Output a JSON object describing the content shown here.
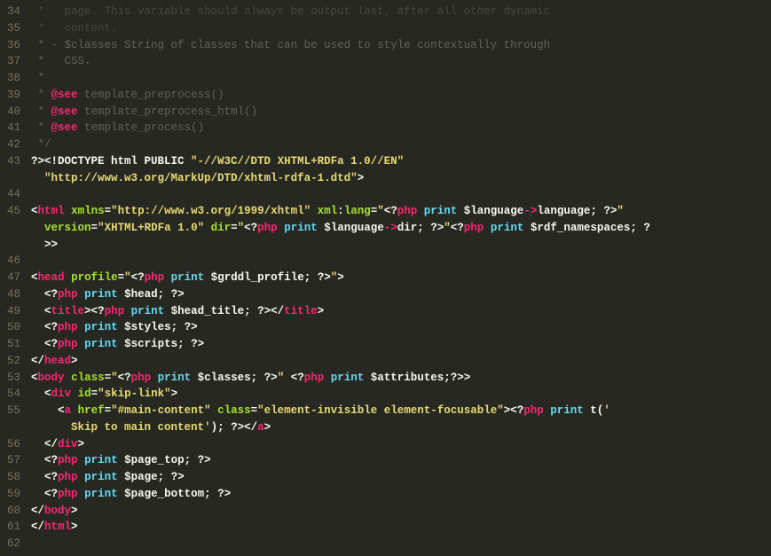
{
  "lines": [
    {
      "num": 34,
      "segs": [
        {
          "cls": "c-comment-faint",
          "t": " *   page. This variable should always be output last, after all other dynamic"
        }
      ]
    },
    {
      "num": 35,
      "segs": [
        {
          "cls": "c-comment-faint",
          "t": " *   content."
        }
      ]
    },
    {
      "num": 36,
      "segs": [
        {
          "cls": "c-comment",
          "t": " * - $classes String of classes that can be used to style contextually through"
        }
      ]
    },
    {
      "num": 37,
      "segs": [
        {
          "cls": "c-comment",
          "t": " *   CSS."
        }
      ]
    },
    {
      "num": 38,
      "segs": [
        {
          "cls": "c-comment",
          "t": " *"
        }
      ]
    },
    {
      "num": 39,
      "segs": [
        {
          "cls": "c-comment",
          "t": " * "
        },
        {
          "cls": "c-tag-red bold",
          "t": "@see"
        },
        {
          "cls": "c-comment",
          "t": " template_preprocess()"
        }
      ]
    },
    {
      "num": 40,
      "segs": [
        {
          "cls": "c-comment",
          "t": " * "
        },
        {
          "cls": "c-tag-red bold",
          "t": "@see"
        },
        {
          "cls": "c-comment",
          "t": " template_preprocess_html()"
        }
      ]
    },
    {
      "num": 41,
      "segs": [
        {
          "cls": "c-comment",
          "t": " * "
        },
        {
          "cls": "c-tag-red bold",
          "t": "@see"
        },
        {
          "cls": "c-comment",
          "t": " template_process()"
        }
      ]
    },
    {
      "num": 42,
      "segs": [
        {
          "cls": "c-comment",
          "t": " */"
        }
      ]
    },
    {
      "num": 43,
      "segs": [
        {
          "cls": "c-white bold",
          "t": "?><!DOCTYPE html PUBLIC "
        },
        {
          "cls": "c-string bold",
          "t": "\"-//W3C//DTD XHTML+RDFa 1.0//EN\""
        }
      ]
    },
    {
      "num": " ",
      "segs": [
        {
          "cls": "c-string bold",
          "t": "  \"http://www.w3.org/MarkUp/DTD/xhtml-rdfa-1.dtd\""
        },
        {
          "cls": "c-white bold",
          "t": ">"
        }
      ]
    },
    {
      "num": 44,
      "segs": []
    },
    {
      "num": 45,
      "segs": [
        {
          "cls": "c-white bold",
          "t": "<"
        },
        {
          "cls": "c-tag-red bold",
          "t": "html"
        },
        {
          "cls": "c-white bold",
          "t": " "
        },
        {
          "cls": "c-attr bold",
          "t": "xmlns"
        },
        {
          "cls": "c-white bold",
          "t": "="
        },
        {
          "cls": "c-string bold",
          "t": "\"http://www.w3.org/1999/xhtml\""
        },
        {
          "cls": "c-white bold",
          "t": " "
        },
        {
          "cls": "c-attr bold",
          "t": "xml"
        },
        {
          "cls": "c-white bold",
          "t": ":"
        },
        {
          "cls": "c-attr bold",
          "t": "lang"
        },
        {
          "cls": "c-white bold",
          "t": "="
        },
        {
          "cls": "c-string bold",
          "t": "\""
        },
        {
          "cls": "c-white bold",
          "t": "<?"
        },
        {
          "cls": "c-tag-red bold",
          "t": "php"
        },
        {
          "cls": "c-white bold",
          "t": " "
        },
        {
          "cls": "c-keyword bold",
          "t": "print"
        },
        {
          "cls": "c-white bold",
          "t": " $language"
        },
        {
          "cls": "c-tag-red bold",
          "t": "->"
        },
        {
          "cls": "c-white bold",
          "t": "language; ?>"
        },
        {
          "cls": "c-string bold",
          "t": "\""
        }
      ]
    },
    {
      "num": " ",
      "segs": [
        {
          "cls": "c-white bold",
          "t": "  "
        },
        {
          "cls": "c-attr bold",
          "t": "version"
        },
        {
          "cls": "c-white bold",
          "t": "="
        },
        {
          "cls": "c-string bold",
          "t": "\"XHTML+RDFa 1.0\""
        },
        {
          "cls": "c-white bold",
          "t": " "
        },
        {
          "cls": "c-attr bold",
          "t": "dir"
        },
        {
          "cls": "c-white bold",
          "t": "="
        },
        {
          "cls": "c-string bold",
          "t": "\""
        },
        {
          "cls": "c-white bold",
          "t": "<?"
        },
        {
          "cls": "c-tag-red bold",
          "t": "php"
        },
        {
          "cls": "c-white bold",
          "t": " "
        },
        {
          "cls": "c-keyword bold",
          "t": "print"
        },
        {
          "cls": "c-white bold",
          "t": " $language"
        },
        {
          "cls": "c-tag-red bold",
          "t": "->"
        },
        {
          "cls": "c-white bold",
          "t": "dir; ?>"
        },
        {
          "cls": "c-string bold",
          "t": "\""
        },
        {
          "cls": "c-white bold",
          "t": "<?"
        },
        {
          "cls": "c-tag-red bold",
          "t": "php"
        },
        {
          "cls": "c-white bold",
          "t": " "
        },
        {
          "cls": "c-keyword bold",
          "t": "print"
        },
        {
          "cls": "c-white bold",
          "t": " $rdf_namespaces; ?"
        }
      ]
    },
    {
      "num": " ",
      "segs": [
        {
          "cls": "c-white bold",
          "t": "  >>"
        }
      ]
    },
    {
      "num": 46,
      "segs": []
    },
    {
      "num": 47,
      "segs": [
        {
          "cls": "c-white bold",
          "t": "<"
        },
        {
          "cls": "c-tag-red bold",
          "t": "head"
        },
        {
          "cls": "c-white bold",
          "t": " "
        },
        {
          "cls": "c-attr bold",
          "t": "profile"
        },
        {
          "cls": "c-white bold",
          "t": "="
        },
        {
          "cls": "c-string bold",
          "t": "\""
        },
        {
          "cls": "c-white bold",
          "t": "<?"
        },
        {
          "cls": "c-tag-red bold",
          "t": "php"
        },
        {
          "cls": "c-white bold",
          "t": " "
        },
        {
          "cls": "c-keyword bold",
          "t": "print"
        },
        {
          "cls": "c-white bold",
          "t": " $grddl_profile; ?>"
        },
        {
          "cls": "c-string bold",
          "t": "\""
        },
        {
          "cls": "c-white bold",
          "t": ">"
        }
      ]
    },
    {
      "num": 48,
      "segs": [
        {
          "cls": "c-white bold",
          "t": "  <?"
        },
        {
          "cls": "c-tag-red bold",
          "t": "php"
        },
        {
          "cls": "c-white bold",
          "t": " "
        },
        {
          "cls": "c-keyword bold",
          "t": "print"
        },
        {
          "cls": "c-white bold",
          "t": " $head; ?>"
        }
      ]
    },
    {
      "num": 49,
      "segs": [
        {
          "cls": "c-white bold",
          "t": "  <"
        },
        {
          "cls": "c-tag-red bold",
          "t": "title"
        },
        {
          "cls": "c-white bold",
          "t": "><?"
        },
        {
          "cls": "c-tag-red bold",
          "t": "php"
        },
        {
          "cls": "c-white bold",
          "t": " "
        },
        {
          "cls": "c-keyword bold",
          "t": "print"
        },
        {
          "cls": "c-white bold",
          "t": " $head_title; ?></"
        },
        {
          "cls": "c-tag-red bold",
          "t": "title"
        },
        {
          "cls": "c-white bold",
          "t": ">"
        }
      ]
    },
    {
      "num": 50,
      "segs": [
        {
          "cls": "c-white bold",
          "t": "  <?"
        },
        {
          "cls": "c-tag-red bold",
          "t": "php"
        },
        {
          "cls": "c-white bold",
          "t": " "
        },
        {
          "cls": "c-keyword bold",
          "t": "print"
        },
        {
          "cls": "c-white bold",
          "t": " $styles; ?>"
        }
      ]
    },
    {
      "num": 51,
      "segs": [
        {
          "cls": "c-white bold",
          "t": "  <?"
        },
        {
          "cls": "c-tag-red bold",
          "t": "php"
        },
        {
          "cls": "c-white bold",
          "t": " "
        },
        {
          "cls": "c-keyword bold",
          "t": "print"
        },
        {
          "cls": "c-white bold",
          "t": " $scripts; ?>"
        }
      ]
    },
    {
      "num": 52,
      "segs": [
        {
          "cls": "c-white bold",
          "t": "</"
        },
        {
          "cls": "c-tag-red bold",
          "t": "head"
        },
        {
          "cls": "c-white bold",
          "t": ">"
        }
      ]
    },
    {
      "num": 53,
      "segs": [
        {
          "cls": "c-white bold",
          "t": "<"
        },
        {
          "cls": "c-tag-red bold",
          "t": "body"
        },
        {
          "cls": "c-white bold",
          "t": " "
        },
        {
          "cls": "c-attr bold",
          "t": "class"
        },
        {
          "cls": "c-white bold",
          "t": "="
        },
        {
          "cls": "c-string bold",
          "t": "\""
        },
        {
          "cls": "c-white bold",
          "t": "<?"
        },
        {
          "cls": "c-tag-red bold",
          "t": "php"
        },
        {
          "cls": "c-white bold",
          "t": " "
        },
        {
          "cls": "c-keyword bold",
          "t": "print"
        },
        {
          "cls": "c-white bold",
          "t": " $classes; ?>"
        },
        {
          "cls": "c-string bold",
          "t": "\""
        },
        {
          "cls": "c-white bold",
          "t": " <?"
        },
        {
          "cls": "c-tag-red bold",
          "t": "php"
        },
        {
          "cls": "c-white bold",
          "t": " "
        },
        {
          "cls": "c-keyword bold",
          "t": "print"
        },
        {
          "cls": "c-white bold",
          "t": " $attributes;?>>"
        }
      ]
    },
    {
      "num": 54,
      "segs": [
        {
          "cls": "c-white bold",
          "t": "  <"
        },
        {
          "cls": "c-tag-red bold",
          "t": "div"
        },
        {
          "cls": "c-white bold",
          "t": " "
        },
        {
          "cls": "c-attr bold",
          "t": "id"
        },
        {
          "cls": "c-white bold",
          "t": "="
        },
        {
          "cls": "c-string bold",
          "t": "\"skip-link\""
        },
        {
          "cls": "c-white bold",
          "t": ">"
        }
      ]
    },
    {
      "num": 55,
      "segs": [
        {
          "cls": "c-white bold",
          "t": "    <"
        },
        {
          "cls": "c-tag-red bold",
          "t": "a"
        },
        {
          "cls": "c-white bold",
          "t": " "
        },
        {
          "cls": "c-attr bold",
          "t": "href"
        },
        {
          "cls": "c-white bold",
          "t": "="
        },
        {
          "cls": "c-string bold",
          "t": "\"#main-content\""
        },
        {
          "cls": "c-white bold",
          "t": " "
        },
        {
          "cls": "c-attr bold",
          "t": "class"
        },
        {
          "cls": "c-white bold",
          "t": "="
        },
        {
          "cls": "c-string bold",
          "t": "\"element-invisible element-focusable\""
        },
        {
          "cls": "c-white bold",
          "t": "><?"
        },
        {
          "cls": "c-tag-red bold",
          "t": "php"
        },
        {
          "cls": "c-white bold",
          "t": " "
        },
        {
          "cls": "c-keyword bold",
          "t": "print"
        },
        {
          "cls": "c-white bold",
          "t": " t("
        },
        {
          "cls": "c-string bold",
          "t": "'"
        }
      ]
    },
    {
      "num": " ",
      "segs": [
        {
          "cls": "c-string bold",
          "t": "      Skip to main content'"
        },
        {
          "cls": "c-white bold",
          "t": "); ?></"
        },
        {
          "cls": "c-tag-red bold",
          "t": "a"
        },
        {
          "cls": "c-white bold",
          "t": ">"
        }
      ]
    },
    {
      "num": 56,
      "segs": [
        {
          "cls": "c-white bold",
          "t": "  </"
        },
        {
          "cls": "c-tag-red bold",
          "t": "div"
        },
        {
          "cls": "c-white bold",
          "t": ">"
        }
      ]
    },
    {
      "num": 57,
      "segs": [
        {
          "cls": "c-white bold",
          "t": "  <?"
        },
        {
          "cls": "c-tag-red bold",
          "t": "php"
        },
        {
          "cls": "c-white bold",
          "t": " "
        },
        {
          "cls": "c-keyword bold",
          "t": "print"
        },
        {
          "cls": "c-white bold",
          "t": " $page_top; ?>"
        }
      ]
    },
    {
      "num": 58,
      "segs": [
        {
          "cls": "c-white bold",
          "t": "  <?"
        },
        {
          "cls": "c-tag-red bold",
          "t": "php"
        },
        {
          "cls": "c-white bold",
          "t": " "
        },
        {
          "cls": "c-keyword bold",
          "t": "print"
        },
        {
          "cls": "c-white bold",
          "t": " $page; ?>"
        }
      ]
    },
    {
      "num": 59,
      "segs": [
        {
          "cls": "c-white bold",
          "t": "  <?"
        },
        {
          "cls": "c-tag-red bold",
          "t": "php"
        },
        {
          "cls": "c-white bold",
          "t": " "
        },
        {
          "cls": "c-keyword bold",
          "t": "print"
        },
        {
          "cls": "c-white bold",
          "t": " $page_bottom; ?>"
        }
      ]
    },
    {
      "num": 60,
      "segs": [
        {
          "cls": "c-white bold",
          "t": "</"
        },
        {
          "cls": "c-tag-red bold",
          "t": "body"
        },
        {
          "cls": "c-white bold",
          "t": ">"
        }
      ]
    },
    {
      "num": 61,
      "segs": [
        {
          "cls": "c-white bold",
          "t": "</"
        },
        {
          "cls": "c-tag-red bold",
          "t": "html"
        },
        {
          "cls": "c-white bold",
          "t": ">"
        }
      ]
    },
    {
      "num": 62,
      "segs": []
    }
  ]
}
